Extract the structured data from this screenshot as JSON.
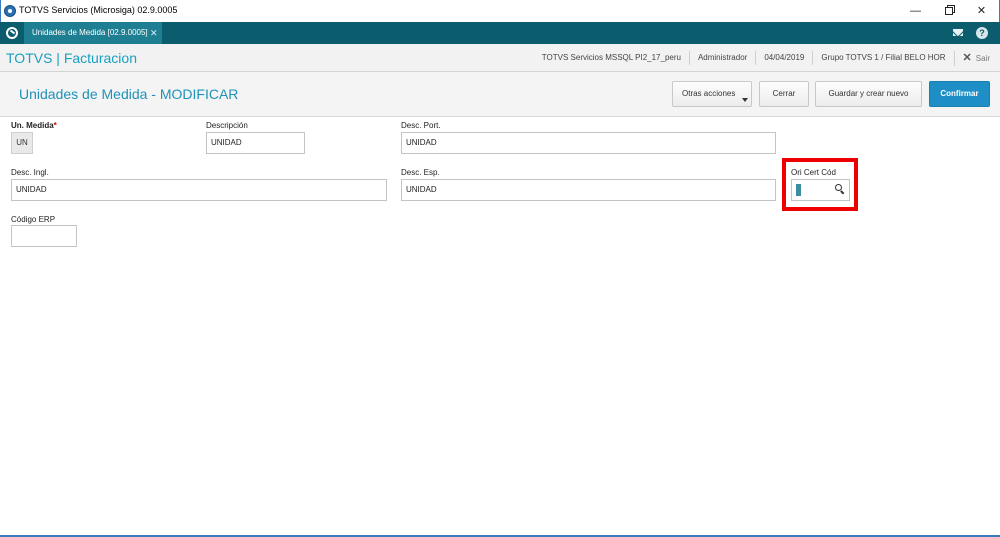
{
  "window": {
    "title": "TOTVS Servicios (Microsiga) 02.9.0005",
    "minimize": "—",
    "close": "✕"
  },
  "tabbar": {
    "active_tab": "Unidades de Medida [02.9.0005]",
    "tab_close": "✕",
    "help": "?"
  },
  "module": {
    "brand": "TOTVS | Facturacion",
    "infos": [
      "TOTVS Servicios MSSQL PI2_17_peru",
      "Administrador",
      "04/04/2019",
      "Grupo TOTVS 1 / Filial BELO HOR"
    ],
    "exit_icon": "✕",
    "exit_label": "Sair"
  },
  "header": {
    "title": "Unidades de Medida - MODIFICAR",
    "buttons": {
      "otras": "Otras acciones",
      "cerrar": "Cerrar",
      "guardar": "Guardar y crear nuevo",
      "confirmar": "Confirmar"
    }
  },
  "form": {
    "un_medida": {
      "label": "Un. Medida",
      "required_mark": "*",
      "value": "UN"
    },
    "descripcion": {
      "label": "Descripción",
      "value": "UNIDAD"
    },
    "desc_port": {
      "label": "Desc. Port.",
      "value": "UNIDAD"
    },
    "desc_ingl": {
      "label": "Desc. Ingl.",
      "value": "UNIDAD"
    },
    "desc_esp": {
      "label": "Desc. Esp.",
      "value": "UNIDAD"
    },
    "ori_cert_cod": {
      "label": "Ori Cert Cód",
      "value": ""
    },
    "codigo_erp": {
      "label": "Código ERP",
      "value": ""
    }
  },
  "colors": {
    "tabbar": "#0b5d6e",
    "accent": "#1e92b8",
    "confirm": "#1e8fc6",
    "highlight": "#ee0000"
  }
}
